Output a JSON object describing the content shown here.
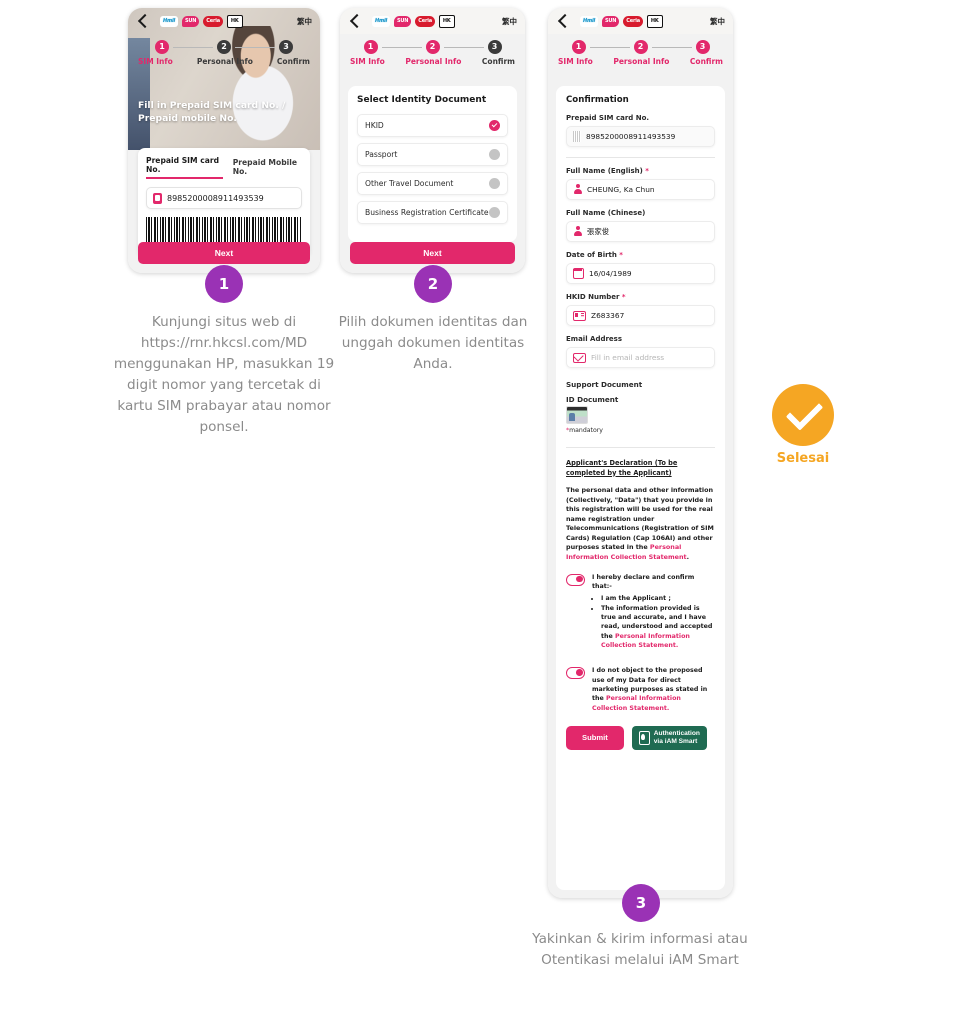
{
  "app": {
    "language_toggle": "繁中",
    "logos": [
      "hm-logo",
      "sun-mobile-logo",
      "ceria-logo",
      "hongkong-logo"
    ]
  },
  "stepper": {
    "steps": [
      {
        "number": "1",
        "label": "SIM Info"
      },
      {
        "number": "2",
        "label": "Personal Info"
      },
      {
        "number": "3",
        "label": "Confirm"
      }
    ]
  },
  "screen1": {
    "hero_title": "Fill in Prepaid SIM card No. /\nPrepaid mobile No.",
    "hero_title_line1": "Fill in Prepaid SIM card No. /",
    "hero_title_line2": "Prepaid mobile No.",
    "tab_sim": "Prepaid SIM card No.",
    "tab_mobile": "Prepaid Mobile No.",
    "sim_number": "8985200008911493539",
    "next_label": "Next"
  },
  "screen2": {
    "section_title": "Select Identity Document",
    "documents": [
      {
        "label": "HKID",
        "selected": true
      },
      {
        "label": "Passport",
        "selected": false
      },
      {
        "label": "Other Travel Document",
        "selected": false
      },
      {
        "label": "Business Registration Certificate",
        "selected": false
      }
    ],
    "next_label": "Next"
  },
  "screen3": {
    "section_title": "Confirmation",
    "sim_label": "Prepaid SIM card No.",
    "sim_number": "8985200008911493539",
    "fields": [
      {
        "label": "Full Name (English)",
        "required": true,
        "value": "CHEUNG, Ka Chun",
        "icon": "person-icon"
      },
      {
        "label": "Full Name (Chinese)",
        "required": false,
        "value": "張家俊",
        "icon": "person-icon"
      },
      {
        "label": "Date of Birth",
        "required": true,
        "value": "16/04/1989",
        "icon": "calendar-icon"
      },
      {
        "label": "HKID Number",
        "required": true,
        "value": "Z683367",
        "icon": "id-card-icon"
      }
    ],
    "email_label": "Email Address",
    "email_placeholder": "Fill in email address",
    "support_document_label": "Support Document",
    "id_document_label": "ID Document",
    "mandatory_note": "mandatory",
    "declaration_title": "Applicant's Declaration (To be completed by the Applicant)",
    "declaration_body_1": "The personal data and other information (Collectively, \"Data\") that you provide in this registration will be used for the real name registration under Telecommunications (Registration of SIM Cards) Regulation (Cap 106AI) and other purposes stated in the ",
    "declaration_link": "Personal Information Collection Statement",
    "declaration_body_end": ".",
    "consent1_intro": "I hereby declare and confirm that:-",
    "consent1_bullets": [
      "I am the Applicant ;",
      "The information provided is true and accurate, and I have read, understood and accepted the "
    ],
    "consent1_link": "Personal Information Collection Statement.",
    "consent2_text": "I do not object to the proposed use of my Data for direct marketing purposes as stated in the ",
    "consent2_link": "Personal Information Collection Statement.",
    "submit_label": "Submit",
    "iam_label_line1": "Authentication",
    "iam_label_line2": "via iAM Smart"
  },
  "badges": [
    {
      "number": "1"
    },
    {
      "number": "2"
    },
    {
      "number": "3"
    }
  ],
  "captions": {
    "step1": "Kunjungi situs web di https://rnr.hkcsl.com/MD menggunakan HP, masukkan 19 digit nomor yang tercetak di kartu SIM prabayar atau nomor ponsel.",
    "step2": "Pilih dokumen identitas dan unggah dokumen identitas Anda.",
    "step3": "Yakinkan & kirim informasi atau Otentikasi melalui iAM Smart"
  },
  "done": {
    "label": "Selesai"
  },
  "colors": {
    "brand_pink": "#e2286b",
    "badge_purple": "#9a32b5",
    "done_orange": "#f5a623",
    "iam_green": "#1f6b52",
    "caption_gray": "#8b8b8b"
  }
}
